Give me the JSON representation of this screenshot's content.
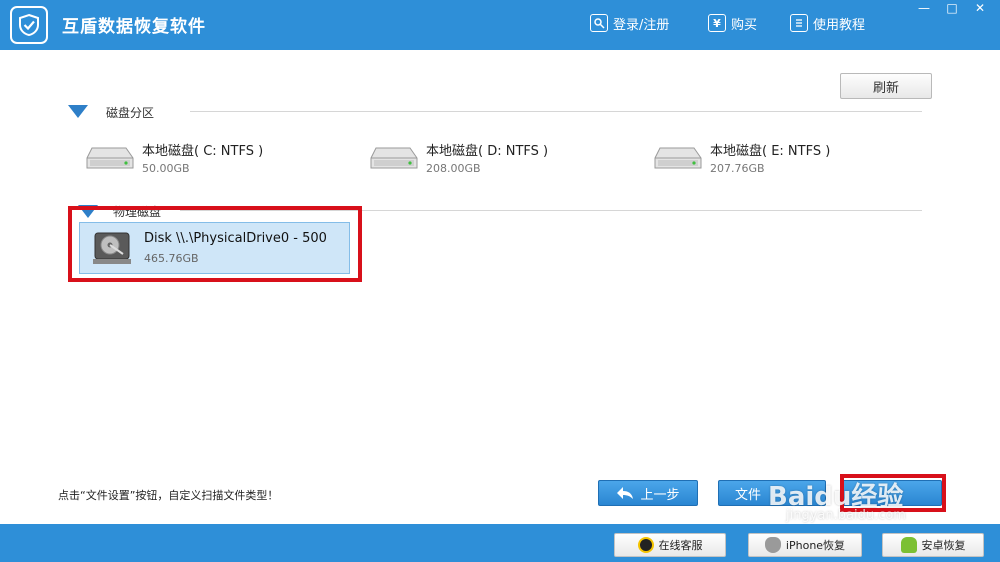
{
  "app": {
    "title": "互盾数据恢复软件"
  },
  "header": {
    "login_label": "登录/注册",
    "buy_label": "购买",
    "tutorial_label": "使用教程",
    "buy_icon_char": "¥",
    "window_controls": [
      "—",
      "□",
      "✕"
    ]
  },
  "toolbar": {
    "refresh_label": "刷新"
  },
  "partitions": {
    "section_label": "磁盘分区",
    "drives": [
      {
        "name": "本地磁盘( C: NTFS )",
        "size": "50.00GB"
      },
      {
        "name": "本地磁盘( D: NTFS )",
        "size": "208.00GB"
      },
      {
        "name": "本地磁盘( E: NTFS )",
        "size": "207.76GB"
      }
    ]
  },
  "physical": {
    "section_label": "物理磁盘",
    "disks": [
      {
        "name": "Disk \\\\.\\PhysicalDrive0 - 500",
        "size": "465.76GB"
      }
    ]
  },
  "hint_text": "点击“文件设置”按钮，自定义扫描文件类型！",
  "nav": {
    "prev_label": "上一步",
    "file_settings_label": "文件"
  },
  "footer": {
    "online_service_label": "在线客服",
    "iphone_recovery_label": "iPhone恢复",
    "android_recovery_label": "安卓恢复"
  },
  "watermark": {
    "brand": "Baidu经验",
    "url": "jingyan.baidu.com"
  },
  "colors": {
    "accent": "#2e8fd8",
    "highlight": "#d8101a",
    "selected": "#cfe6f8"
  }
}
